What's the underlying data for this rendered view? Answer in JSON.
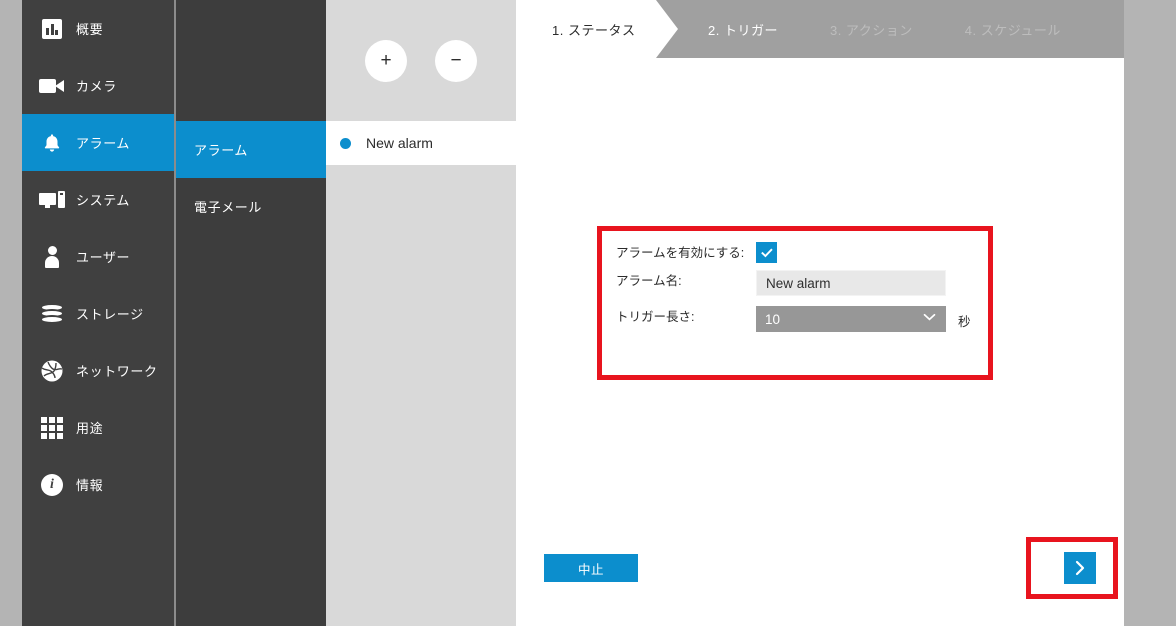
{
  "colors": {
    "accent": "#0c8ecd",
    "sidebar_bg": "#404040",
    "subnav_bg": "#3d3d3d",
    "list_panel_bg": "#d9d9d9",
    "wizard_bg": "#a0a0a0",
    "highlight_red": "#e8141e",
    "select_bg": "#979797",
    "input_bg": "#e8e8e8",
    "page_margin": "#b4b4b4"
  },
  "sidebar": {
    "items": [
      {
        "label": "概要",
        "icon": "bar-chart-icon",
        "active": false
      },
      {
        "label": "カメラ",
        "icon": "video-camera-icon",
        "active": false
      },
      {
        "label": "アラーム",
        "icon": "bell-icon",
        "active": true
      },
      {
        "label": "システム",
        "icon": "desktop-tower-icon",
        "active": false
      },
      {
        "label": "ユーザー",
        "icon": "user-icon",
        "active": false
      },
      {
        "label": "ストレージ",
        "icon": "database-icon",
        "active": false
      },
      {
        "label": "ネットワーク",
        "icon": "globe-icon",
        "active": false
      },
      {
        "label": "用途",
        "icon": "grid-apps-icon",
        "active": false
      },
      {
        "label": "情報",
        "icon": "info-icon",
        "active": false
      }
    ]
  },
  "subnav": {
    "items": [
      {
        "label": "アラーム",
        "active": true
      },
      {
        "label": "電子メール",
        "active": false
      }
    ]
  },
  "list_panel": {
    "add_label": "+",
    "remove_label": "−",
    "alarms": [
      {
        "name": "New alarm",
        "selected": true
      }
    ]
  },
  "wizard": {
    "steps": [
      {
        "label": "1. ステータス",
        "state": "active"
      },
      {
        "label": "2. トリガー",
        "state": "next"
      },
      {
        "label": "3. アクション",
        "state": "disabled"
      },
      {
        "label": "4. スケジュール",
        "state": "disabled"
      }
    ]
  },
  "form": {
    "enable_alarm_label": "アラームを有効にする:",
    "enable_alarm_checked": true,
    "alarm_name_label": "アラーム名:",
    "alarm_name_value": "New alarm",
    "alarm_name_placeholder": "New alarm",
    "trigger_length_label": "トリガー長さ:",
    "trigger_length_value": "10",
    "trigger_length_options": [
      "10"
    ],
    "trigger_length_unit": "秒"
  },
  "actions": {
    "cancel_label": "中止",
    "next_icon": "chevron-right-icon"
  }
}
